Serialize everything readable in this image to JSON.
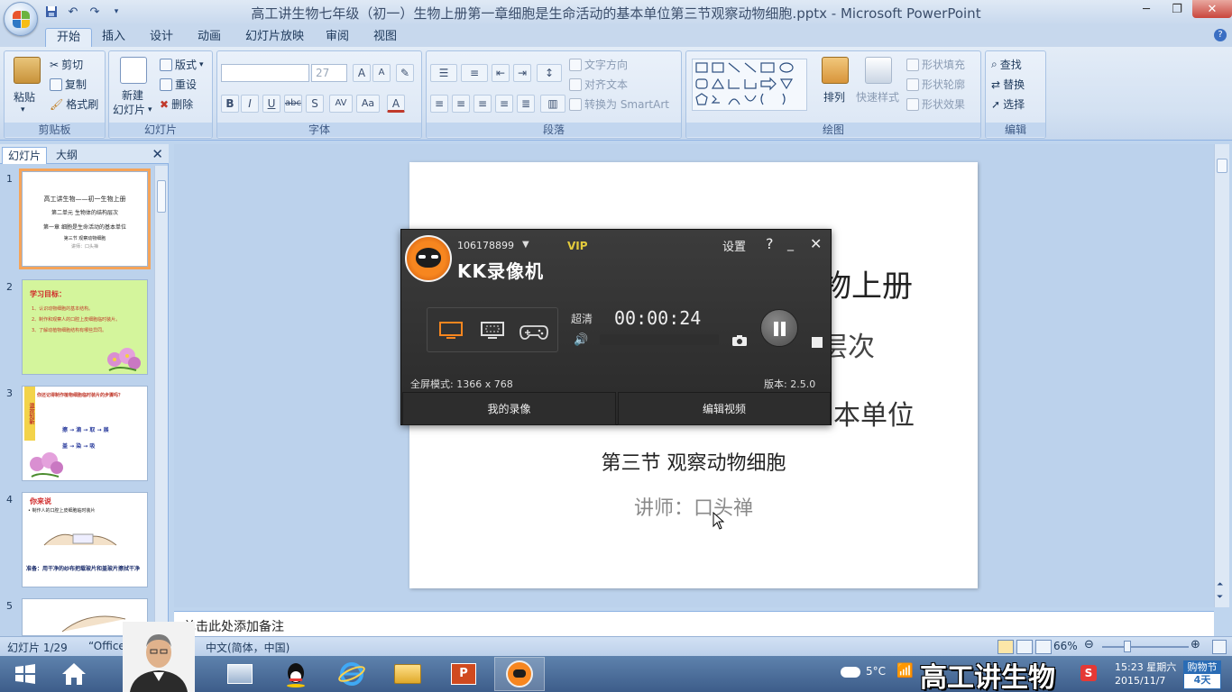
{
  "window": {
    "title": "高工讲生物七年级（初一）生物上册第一章细胞是生命活动的基本单位第三节观察动物细胞.pptx - Microsoft PowerPoint"
  },
  "ribbon": {
    "tabs": [
      "开始",
      "插入",
      "设计",
      "动画",
      "幻灯片放映",
      "审阅",
      "视图"
    ],
    "active_tab": "开始",
    "clipboard": {
      "label": "剪贴板",
      "paste": "粘贴",
      "cut": "剪切",
      "copy": "复制",
      "format_painter": "格式刷"
    },
    "slides": {
      "label": "幻灯片",
      "new_slide_1": "新建",
      "new_slide_2": "幻灯片",
      "layout": "版式",
      "reset": "重设",
      "delete": "删除"
    },
    "font": {
      "label": "字体",
      "font_size": "27"
    },
    "paragraph": {
      "label": "段落",
      "text_direction": "文字方向",
      "align_text": "对齐文本",
      "smartart": "转换为 SmartArt"
    },
    "drawing": {
      "label": "绘图",
      "arrange": "排列",
      "quick_styles": "快速样式",
      "shape_fill": "形状填充",
      "shape_outline": "形状轮廓",
      "shape_effects": "形状效果"
    },
    "editing": {
      "label": "编辑",
      "find": "查找",
      "replace": "替换",
      "select": "选择"
    }
  },
  "slides_pane": {
    "tabs": [
      "幻灯片",
      "大纲"
    ],
    "thumbs": [
      {
        "num": "1",
        "lines": [
          "高工讲生物——初一生物上册",
          "第二单元 生物体的结构层次",
          "第一章 细胞是生命活动的基本单位",
          "第三节 观察动物细胞",
          "讲师：口头禅"
        ]
      },
      {
        "num": "2",
        "title": "学习目标：",
        "lines": [
          "1、认识动物细胞的基本结构。",
          "2、制作和观察人的口腔上皮细胞临时装片。",
          "3、了解动植物细胞结构有哪些异同。"
        ]
      },
      {
        "num": "3",
        "title": "你还记得制作植物细胞临时装片的步骤吗？",
        "side": "温故知新",
        "lines": [
          "擦 → 滴 → 取 → 展",
          "盖 → 染 → 吸"
        ]
      },
      {
        "num": "4",
        "title": "你来说",
        "lines": [
          "• 制作人的口腔上皮细胞临时装片",
          "准备：用干净的纱布把载玻片和盖玻片擦拭干净"
        ]
      },
      {
        "num": "5"
      }
    ]
  },
  "slide": {
    "line1": "高工讲生物——初一生物上册",
    "line2": "第二单元 生物体的结构层次",
    "line3": "第一章 细胞是生命活动的基本单位",
    "line4": "第三节 观察动物细胞",
    "line5": "讲师：口头禅"
  },
  "notes": {
    "placeholder": "单击此处添加备注"
  },
  "statusbar": {
    "slide_num": "幻灯片 1/29",
    "theme": "“Office",
    "language": "中文(简体，中国)",
    "zoom": "66%"
  },
  "recorder": {
    "user_id": "106178899",
    "vip": "VIP",
    "brand": "KK录像机",
    "settings": "设置",
    "help": "?",
    "quality": "超清",
    "timer": "00:00:24",
    "fullscreen_mode": "全屏模式: 1366 x 768",
    "version": "版本: 2.5.0",
    "my_recordings": "我的录像",
    "edit_video": "编辑视频"
  },
  "taskbar": {
    "weather": "5°C",
    "watermark": "高工讲生物",
    "time": "15:23 星期六",
    "date": "2015/11/7",
    "gift_top": "购物节",
    "gift_bottom": "4天"
  },
  "colors": {
    "ribbon_bg": "#d3e1f2",
    "recorder_bg": "#2f2f2f",
    "recorder_accent": "#f7861f",
    "taskbar_bg": "#4a6d9c",
    "thumb_selected": "#f5a45a"
  }
}
